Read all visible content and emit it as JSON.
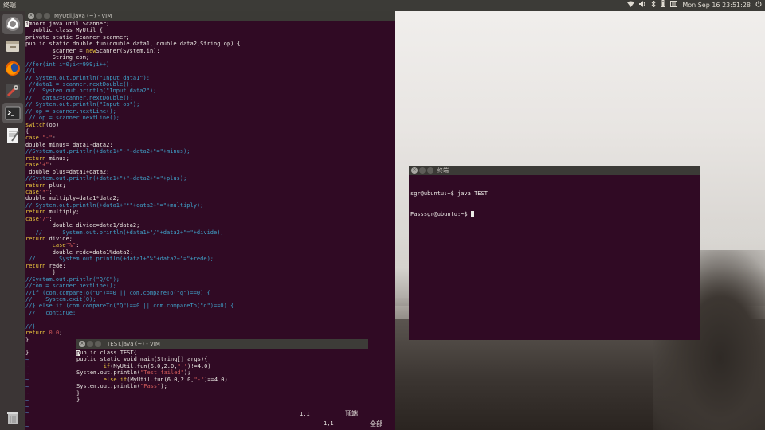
{
  "top_panel": {
    "app_title": "终端",
    "datetime": "Mon Sep 16 23:51:28",
    "icons": [
      "network-icon",
      "volume-icon",
      "bluetooth-icon",
      "battery-icon",
      "input-method-icon",
      "power-icon"
    ]
  },
  "launcher": {
    "items": [
      "ubuntu-dash-icon",
      "files-icon",
      "firefox-icon",
      "settings-icon",
      "terminal-icon",
      "text-editor-icon",
      "trash-icon"
    ]
  },
  "vim_main": {
    "title": "MyUtil.java (~) - VIM",
    "lines": [
      [
        [
          "kw",
          "i"
        ],
        [
          "",
          "mport java.util.Scanner;"
        ]
      ],
      [
        [
          "",
          "  public class MyUtil {"
        ]
      ],
      [
        [
          "",
          "private static Scanner scanner;"
        ]
      ],
      [
        [
          "",
          "public static double fun(double data1, double data2,String op) {"
        ]
      ],
      [
        [
          "",
          "        scanner = "
        ],
        [
          "kw",
          "new"
        ],
        [
          "",
          "Scanner(System.in);"
        ]
      ],
      [
        [
          "",
          "        String com;"
        ]
      ],
      [
        [
          "c",
          "//for(int i=0;i<=999;i++)"
        ]
      ],
      [
        [
          "c",
          "//{"
        ]
      ],
      [
        [
          "c",
          "// System.out.println(\"Input data1\");"
        ]
      ],
      [
        [
          "c",
          " //data1 = scanner.nextDouble();"
        ]
      ],
      [
        [
          "c",
          " //  System.out.println(\"Input data2\");"
        ]
      ],
      [
        [
          "c",
          "//   data2=scanner.nextDouble();"
        ]
      ],
      [
        [
          "c",
          "// System.out.println(\"Input op\");"
        ]
      ],
      [
        [
          "c",
          "// op = scanner.nextLine();"
        ]
      ],
      [
        [
          "c",
          " // op = scanner.nextLine();"
        ]
      ],
      [
        [
          "kw",
          "switch"
        ],
        [
          "",
          "(op)"
        ]
      ],
      [
        [
          "",
          "{"
        ]
      ],
      [
        [
          "kw",
          "case"
        ],
        [
          "s",
          " \"-\""
        ],
        [
          "",
          ":"
        ]
      ],
      [
        [
          "",
          "double minus= data1-data2;"
        ]
      ],
      [
        [
          "c",
          "//System.out.println(+data1+\"-\"+data2+\"=\"+minus);"
        ]
      ],
      [
        [
          "kw",
          "return"
        ],
        [
          "",
          " minus;"
        ]
      ],
      [
        [
          "kw",
          "case"
        ],
        [
          "s",
          "\"+\""
        ],
        [
          "",
          ":"
        ]
      ],
      [
        [
          "",
          " double plus=data1+data2;"
        ]
      ],
      [
        [
          "c",
          "//System.out.println(+data1+\"+\"+data2+\"=\"+plus);"
        ]
      ],
      [
        [
          "kw",
          "return"
        ],
        [
          "",
          " plus;"
        ]
      ],
      [
        [
          "kw",
          "case"
        ],
        [
          "s",
          "\"*\""
        ],
        [
          "",
          ":"
        ]
      ],
      [
        [
          "",
          "double multiply=data1*data2;"
        ]
      ],
      [
        [
          "c",
          "// System.out.println(+data1+\"*\"+data2+\"=\"+multiply);"
        ]
      ],
      [
        [
          "kw",
          "return"
        ],
        [
          "",
          " multiply;"
        ]
      ],
      [
        [
          "kw",
          "case"
        ],
        [
          "s",
          "\"/\""
        ],
        [
          "",
          ":"
        ]
      ],
      [
        [
          "",
          "        double divide=data1/data2;"
        ]
      ],
      [
        [
          "c",
          "   //      System.out.println(+data1+\"/\"+data2+\"=\"+divide);"
        ]
      ],
      [
        [
          "kw",
          "return"
        ],
        [
          "",
          " divide;"
        ]
      ],
      [
        [
          "",
          "        "
        ],
        [
          "kw",
          "case"
        ],
        [
          "s",
          "\"%\""
        ],
        [
          "",
          ":"
        ]
      ],
      [
        [
          "",
          "        double rede=data1%data2;"
        ]
      ],
      [
        [
          "c",
          " //       System.out.println(+data1+\"%\"+data2+\"=\"+rede);"
        ]
      ],
      [
        [
          "kw",
          "return"
        ],
        [
          "",
          " rede;"
        ]
      ],
      [
        [
          "",
          "        }"
        ]
      ],
      [
        [
          "c",
          "//System.out.println(\"Q/C\");"
        ]
      ],
      [
        [
          "c",
          "//com = scanner.nextLine();"
        ]
      ],
      [
        [
          "c",
          "//if (com.compareTo(\"Q\")==0 || com.compareTo(\"q\")==0) {"
        ]
      ],
      [
        [
          "c",
          "//    System.exit(0);"
        ]
      ],
      [
        [
          "c",
          "//} else if (com.compareTo(\"Q\")==0 || com.compareTo(\"q\")==0) {"
        ]
      ],
      [
        [
          "c",
          " //   continue;"
        ]
      ],
      [
        [
          "",
          ""
        ]
      ],
      [
        [
          "c",
          "//}"
        ]
      ],
      [
        [
          "kw",
          "return"
        ],
        [
          "n",
          " 0.0"
        ],
        [
          "",
          ";"
        ]
      ],
      [
        [
          "",
          "}"
        ]
      ],
      [
        [
          "",
          ""
        ]
      ],
      [
        [
          "",
          "}"
        ]
      ],
      [
        [
          "t",
          "~"
        ]
      ],
      [
        [
          "t",
          "~"
        ]
      ],
      [
        [
          "t",
          "~"
        ]
      ],
      [
        [
          "t",
          "~"
        ]
      ],
      [
        [
          "t",
          "~"
        ]
      ],
      [
        [
          "t",
          "~"
        ]
      ],
      [
        [
          "t",
          "~"
        ]
      ],
      [
        [
          "t",
          "~"
        ]
      ],
      [
        [
          "t",
          "~"
        ]
      ],
      [
        [
          "t",
          "~"
        ]
      ],
      [
        [
          "t",
          "~"
        ]
      ],
      [
        [
          "t",
          "~"
        ]
      ]
    ],
    "position": "1,1",
    "scroll": "全部"
  },
  "vim_test": {
    "title": "TEST.java (~) - VIM",
    "lines": [
      [
        [
          "kw",
          "p"
        ],
        [
          "",
          "ublic class TEST{"
        ]
      ],
      [
        [
          "",
          "public static void main(String[] args){"
        ]
      ],
      [
        [
          "",
          "        "
        ],
        [
          "kw",
          "if"
        ],
        [
          "",
          "(MyUtil.fun(6.0,2.0,"
        ],
        [
          "s",
          "\"-\""
        ],
        [
          "",
          ")!=4.0)"
        ]
      ],
      [
        [
          "",
          "System.out.println("
        ],
        [
          "s",
          "\"Test failed\""
        ],
        [
          "",
          ");"
        ]
      ],
      [
        [
          "",
          "        "
        ],
        [
          "kw",
          "else if"
        ],
        [
          "",
          "(MyUtil.fun(6.0,2.0,"
        ],
        [
          "s",
          "\"-\""
        ],
        [
          "",
          ")==4.0)"
        ]
      ],
      [
        [
          "",
          "System.out.println("
        ],
        [
          "s",
          "\"Pass\""
        ],
        [
          "",
          ");"
        ]
      ],
      [
        [
          "",
          "}"
        ]
      ],
      [
        [
          "",
          "}"
        ]
      ]
    ],
    "position": "1,1",
    "scroll": "顶端"
  },
  "terminal": {
    "title": "终端",
    "lines": [
      "sgr@ubuntu:~$ java TEST",
      "Passsgr@ubuntu:~$ "
    ]
  }
}
